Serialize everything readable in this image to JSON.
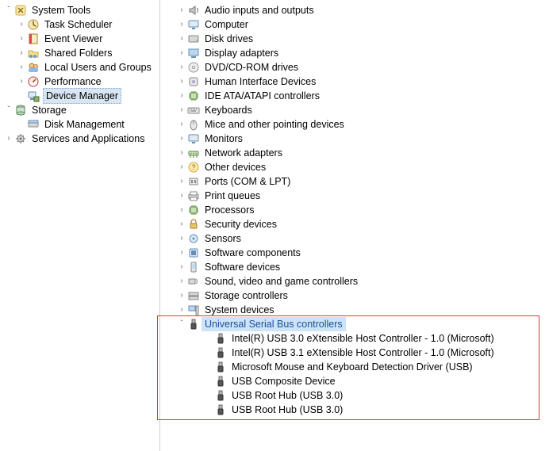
{
  "left": {
    "system_tools": {
      "label": "System Tools",
      "expanded": true
    },
    "task_scheduler": "Task Scheduler",
    "event_viewer": "Event Viewer",
    "shared_folders": "Shared Folders",
    "local_users_groups": "Local Users and Groups",
    "performance": "Performance",
    "device_manager": "Device Manager",
    "storage": {
      "label": "Storage",
      "expanded": true
    },
    "disk_management": "Disk Management",
    "services_apps": "Services and Applications"
  },
  "right": {
    "categories": {
      "audio_io": "Audio inputs and outputs",
      "computer": "Computer",
      "disk_drives": "Disk drives",
      "display_adapters": "Display adapters",
      "dvd_cd": "DVD/CD-ROM drives",
      "hid": "Human Interface Devices",
      "ide": "IDE ATA/ATAPI controllers",
      "keyboards": "Keyboards",
      "mice": "Mice and other pointing devices",
      "monitors": "Monitors",
      "network": "Network adapters",
      "other": "Other devices",
      "ports": "Ports (COM & LPT)",
      "print_queues": "Print queues",
      "processors": "Processors",
      "security": "Security devices",
      "sensors": "Sensors",
      "software_components": "Software components",
      "software_devices": "Software devices",
      "sound": "Sound, video and game controllers",
      "storage_controllers": "Storage controllers",
      "system_devices": "System devices",
      "usb": "Universal Serial Bus controllers"
    },
    "usb_children": [
      "Intel(R) USB 3.0 eXtensible Host Controller - 1.0 (Microsoft)",
      "Intel(R) USB 3.1 eXtensible Host Controller - 1.0 (Microsoft)",
      "Microsoft Mouse and Keyboard Detection Driver (USB)",
      "USB Composite Device",
      "USB Root Hub (USB 3.0)",
      "USB Root Hub (USB 3.0)"
    ]
  }
}
